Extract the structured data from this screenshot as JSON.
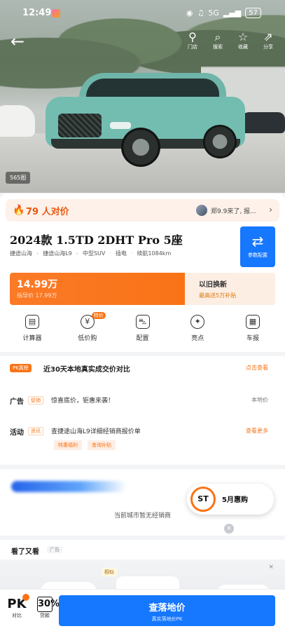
{
  "status_bar": {
    "time": "12:49",
    "network": "5G",
    "battery": "57"
  },
  "header": {
    "back_icon": "arrow-left-icon",
    "actions": [
      {
        "icon": "location-pin-icon",
        "label": "门店"
      },
      {
        "icon": "search-icon",
        "label": "搜索"
      },
      {
        "icon": "star-icon",
        "label": "收藏"
      },
      {
        "icon": "share-icon",
        "label": "分享"
      }
    ]
  },
  "hero": {
    "photo_count": "565图"
  },
  "watch_bar": {
    "count_text": "79 人对价",
    "user_text": "郑9.9来了, 报..."
  },
  "model": {
    "title": "2024款 1.5TD 2DHT Pro 5座",
    "meta": [
      "捷途山海",
      "捷途山海L9",
      "中型SUV",
      "插电",
      "续航1084km"
    ],
    "compare_label": "参数配置"
  },
  "price": {
    "main": "14.99万",
    "sub": "指导价 17.99万",
    "tradein_title": "以旧换新",
    "tradein_sub": "最高送5万补贴"
  },
  "tools": [
    {
      "label": "计算器",
      "icon": "calculator-icon"
    },
    {
      "label": "低价购",
      "icon": "discount-icon",
      "badge": "特价"
    },
    {
      "label": "配置",
      "icon": "car-config-icon"
    },
    {
      "label": "亮点",
      "icon": "highlight-icon"
    },
    {
      "label": "车报",
      "icon": "report-icon"
    }
  ],
  "rank": {
    "tag": "PK真榜",
    "text": "近30天本地真实成交价对比",
    "link": "点击查看"
  },
  "ad_row": {
    "label": "广告",
    "tag": "促销",
    "text": "惊喜底价，钜惠来袭！",
    "link": "本地价"
  },
  "activity_row": {
    "label": "活动",
    "tag": "资讯",
    "text": "查捷途山海L9详细经销商报价单",
    "link": "查看更多",
    "chips": [
      "特惠福利",
      "查询补贴"
    ]
  },
  "dealer": {
    "empty_text": "当前城市暂无经销商"
  },
  "float_ad": {
    "logo_text": "ST",
    "text": "5月惠购"
  },
  "guess": {
    "title": "看了又看",
    "ad_label": "广告",
    "chip": "相似"
  },
  "bottom_bar": {
    "pk_label": "对比",
    "pk_icon": "PK",
    "loan_label": "贷款",
    "loan_icon": "30%",
    "cta_main": "查落地价",
    "cta_sub": "真实落地价PK"
  }
}
